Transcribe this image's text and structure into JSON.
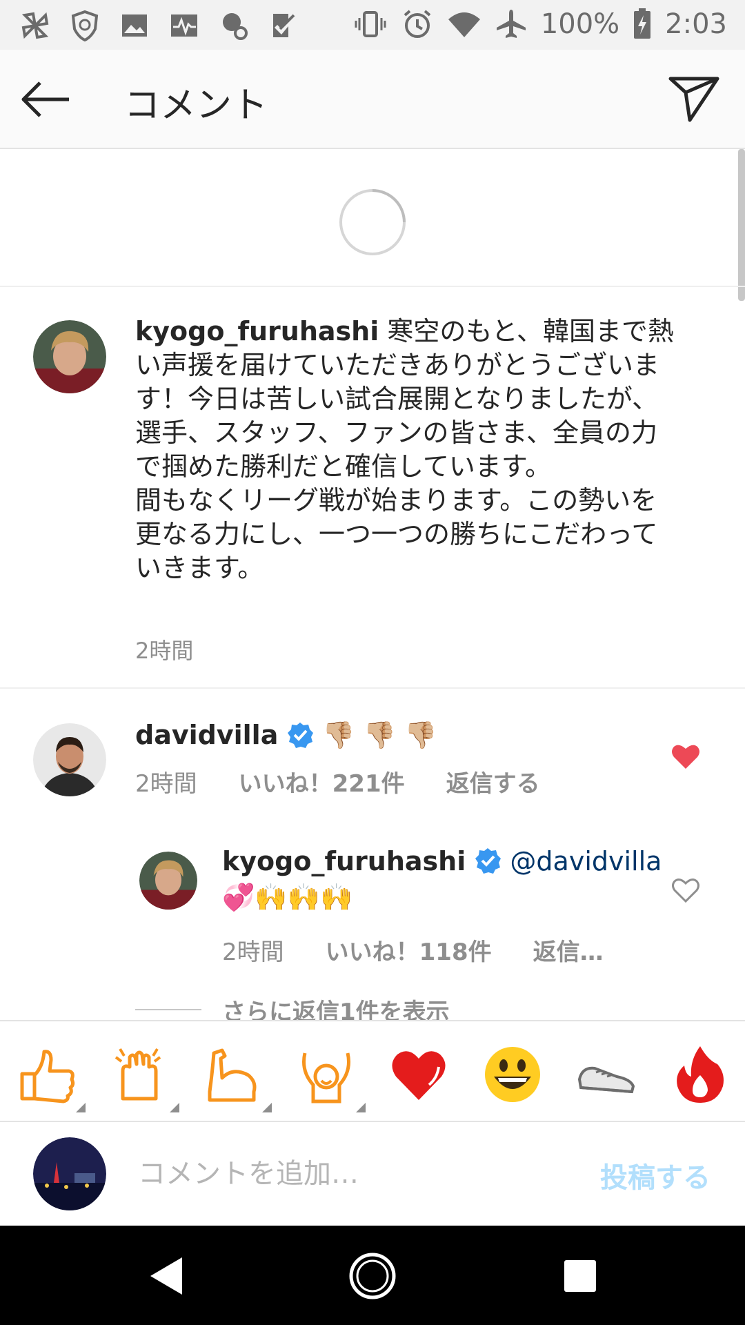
{
  "status_bar": {
    "battery": "100%",
    "time": "2:03",
    "icons": [
      "pinwheel-icon",
      "shield-icon",
      "image-icon",
      "pulse-icon",
      "account-key-icon",
      "task-check-icon",
      "vibrate-icon",
      "alarm-icon",
      "wifi-icon",
      "airplane-icon",
      "battery-charging-icon"
    ]
  },
  "header": {
    "title": "コメント",
    "back_icon": "back-arrow-icon",
    "send_icon": "send-icon"
  },
  "caption": {
    "username": "kyogo_furuhashi",
    "text": "寒空のもと、韓国まで熱い声援を届けていただきありがとうございます！今日は苦しい試合展開となりましたが、選手、スタッフ、ファンの皆さま、全員の力で掴めた勝利だと確信しています。\n間もなくリーグ戦が始まります。この勢いを更なる力にし、一つ一つの勝ちにこだわっていきます。",
    "time": "2時間"
  },
  "comment": {
    "username": "davidvilla",
    "emojis": "👎🏼 👎🏼 👎🏼",
    "time": "2時間",
    "likes": "いいね！221件",
    "reply_label": "返信する",
    "liked": true
  },
  "reply": {
    "username": "kyogo_furuhashi",
    "mention": "@davidvilla",
    "emojis": "💞🙌🙌🙌",
    "time": "2時間",
    "likes": "いいね！118件",
    "reply_label": "返信…",
    "liked": false
  },
  "more_replies": "さらに返信1件を表示",
  "emoji_bar": [
    "thumbs-up-icon",
    "clap-icon",
    "muscle-icon",
    "raised-hands-icon",
    "heart-icon",
    "grinning-face-icon",
    "sneaker-icon",
    "fire-icon"
  ],
  "input": {
    "placeholder": "コメントを追加…",
    "post_label": "投稿する"
  },
  "colors": {
    "like_red": "#ed4956",
    "verified_blue": "#3897f0",
    "mention_blue": "#003569",
    "post_disabled": "#b2dffc",
    "emoji_orange": "#f7941d"
  }
}
